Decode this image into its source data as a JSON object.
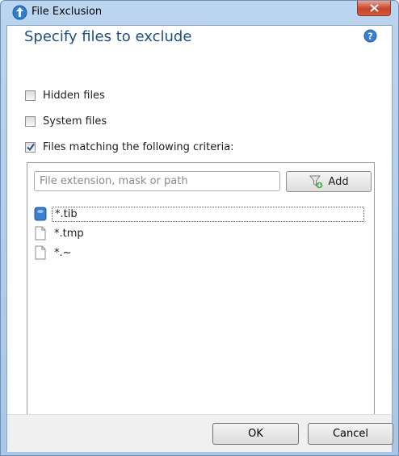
{
  "window": {
    "title": "File Exclusion",
    "icons": {
      "app": "app-logo-icon",
      "close": "close-icon"
    }
  },
  "dialog": {
    "heading": "Specify files to exclude",
    "help_icon": "help-icon"
  },
  "options": [
    {
      "label": "Hidden files",
      "checked": false
    },
    {
      "label": "System files",
      "checked": false
    },
    {
      "label": "Files matching the following criteria:",
      "checked": true
    }
  ],
  "criteria": {
    "input_placeholder": "File extension, mask or path",
    "input_value": "",
    "add_label": "Add",
    "add_icon": "filter-add-icon",
    "items": [
      {
        "label": "*.tib",
        "icon": "backup-file-icon",
        "selected": true
      },
      {
        "label": "*.tmp",
        "icon": "file-icon",
        "selected": false
      },
      {
        "label": "*.~",
        "icon": "file-icon",
        "selected": false
      }
    ]
  },
  "footer": {
    "ok_label": "OK",
    "cancel_label": "Cancel"
  },
  "colors": {
    "heading": "#1c4e8a",
    "titlebar": "#bcd5ef",
    "close_button": "#c7442a",
    "footer_bg": "#f0f0f0"
  }
}
